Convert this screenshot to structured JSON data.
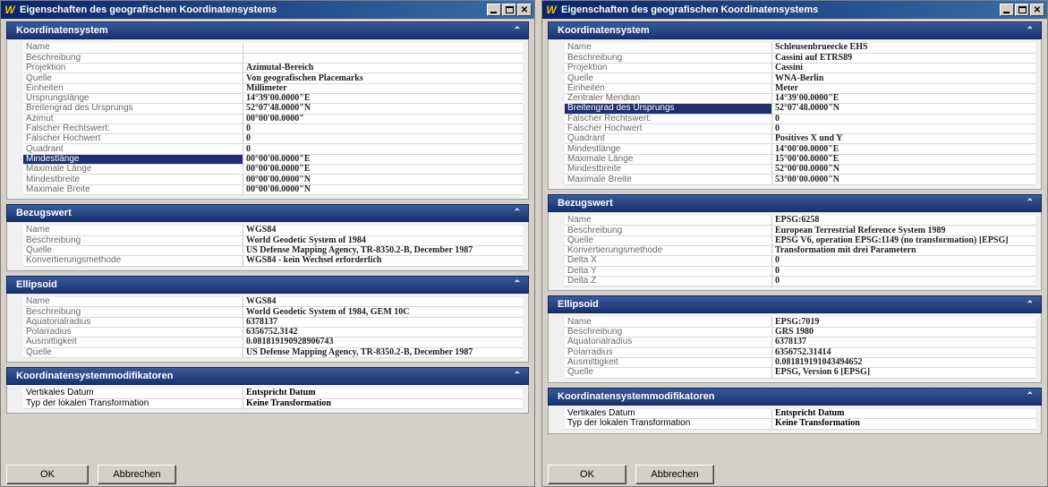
{
  "left": {
    "title": "Eigenschaften des geografischen Koordinatensystems",
    "app_icon": "wa-globe-icon",
    "sections": [
      {
        "title": "Koordinatensystem",
        "rows": [
          {
            "k": "Name",
            "v": ""
          },
          {
            "k": "Beschreibung",
            "v": ""
          },
          {
            "k": "Projektion",
            "v": "Azimutal-Bereich"
          },
          {
            "k": "Quelle",
            "v": "Von geografischen Placemarks"
          },
          {
            "k": "Einheiten",
            "v": "Millimeter"
          },
          {
            "k": "Ursprungslänge",
            "v": "14°39'00.0000\"E"
          },
          {
            "k": "Breitengrad des Ursprungs",
            "v": "52°07'48.0000\"N"
          },
          {
            "k": "Azimut",
            "v": "00°00'00.0000\""
          },
          {
            "k": "Falscher Rechtswert:",
            "v": "0"
          },
          {
            "k": "Falscher Hochwert",
            "v": "0"
          },
          {
            "k": "Quadrant",
            "v": "0"
          },
          {
            "k": "Mindestlänge",
            "v": "00°00'00.0000\"E",
            "selected": true
          },
          {
            "k": "Maximale Länge",
            "v": "00°00'00.0000\"E"
          },
          {
            "k": "Mindestbreite",
            "v": "00°00'00.0000\"N"
          },
          {
            "k": "Maximale Breite",
            "v": "00°00'00.0000\"N"
          }
        ]
      },
      {
        "title": "Bezugswert",
        "rows": [
          {
            "k": "Name",
            "v": "WGS84"
          },
          {
            "k": "Beschreibung",
            "v": "World Geodetic System of 1984"
          },
          {
            "k": "Quelle",
            "v": "US Defense Mapping Agency, TR-8350.2-B, December 1987"
          },
          {
            "k": "Konvertierungsmethode",
            "v": "WGS84 - kein Wechsel erforderlich"
          }
        ]
      },
      {
        "title": "Ellipsoid",
        "rows": [
          {
            "k": "Name",
            "v": "WGS84"
          },
          {
            "k": "Beschreibung",
            "v": "World Geodetic System of 1984, GEM 10C"
          },
          {
            "k": "Äquatorialradius",
            "v": "6378137"
          },
          {
            "k": "Polarradius",
            "v": "6356752.3142"
          },
          {
            "k": "Ausmittigkeit",
            "v": "0.081819190928906743"
          },
          {
            "k": "Quelle",
            "v": "US Defense Mapping Agency, TR-8350.2-B, December 1987"
          }
        ]
      },
      {
        "title": "Koordinatensystemmodifikatoren",
        "dark": true,
        "rows": [
          {
            "k": "Vertikales Datum",
            "v": "Entspricht Datum"
          },
          {
            "k": "Typ der lokalen Transformation",
            "v": "Keine Transformation"
          }
        ]
      }
    ],
    "ok_label": "OK",
    "cancel_label": "Abbrechen"
  },
  "right": {
    "title": "Eigenschaften des geografischen Koordinatensystems",
    "app_icon": "wa-globe-icon",
    "sections": [
      {
        "title": "Koordinatensystem",
        "rows": [
          {
            "k": "Name",
            "v": "Schleusenbrueecke EHS"
          },
          {
            "k": "Beschreibung",
            "v": "Cassini auf ETRS89"
          },
          {
            "k": "Projektion",
            "v": "Cassini"
          },
          {
            "k": "Quelle",
            "v": "WNA-Berlin"
          },
          {
            "k": "Einheiten",
            "v": "Meter"
          },
          {
            "k": "Zentraler Meridian",
            "v": "14°39'00.0000\"E"
          },
          {
            "k": "Breitengrad des Ursprungs",
            "v": "52°07'48.0000\"N",
            "selected": true
          },
          {
            "k": "Falscher Rechtswert:",
            "v": "0"
          },
          {
            "k": "Falscher Hochwert",
            "v": "0"
          },
          {
            "k": "Quadrant",
            "v": "Positives X und Y"
          },
          {
            "k": "Mindestlänge",
            "v": "14°00'00.0000\"E"
          },
          {
            "k": "Maximale Länge",
            "v": "15°00'00.0000\"E"
          },
          {
            "k": "Mindestbreite",
            "v": "52°00'00.0000\"N"
          },
          {
            "k": "Maximale Breite",
            "v": "53°00'00.0000\"N"
          }
        ]
      },
      {
        "title": "Bezugswert",
        "rows": [
          {
            "k": "Name",
            "v": "EPSG:6258"
          },
          {
            "k": "Beschreibung",
            "v": "European Terrestrial Reference System 1989"
          },
          {
            "k": "Quelle",
            "v": "EPSG V6, operation EPSG:1149 (no transformation) [EPSG]"
          },
          {
            "k": "Konvertierungsmethode",
            "v": "Transformation mit drei Parametern"
          },
          {
            "k": "Delta X",
            "v": "0"
          },
          {
            "k": "Delta Y",
            "v": "0"
          },
          {
            "k": "Delta Z",
            "v": "0"
          }
        ]
      },
      {
        "title": "Ellipsoid",
        "rows": [
          {
            "k": "Name",
            "v": "EPSG:7019"
          },
          {
            "k": "Beschreibung",
            "v": "GRS 1980"
          },
          {
            "k": "Äquatorialradius",
            "v": "6378137"
          },
          {
            "k": "Polarradius",
            "v": "6356752.31414"
          },
          {
            "k": "Ausmittigkeit",
            "v": "0.081819191043494652"
          },
          {
            "k": "Quelle",
            "v": "EPSG, Version 6 [EPSG]"
          }
        ]
      },
      {
        "title": "Koordinatensystemmodifikatoren",
        "dark": true,
        "rows": [
          {
            "k": "Vertikales Datum",
            "v": "Entspricht Datum"
          },
          {
            "k": "Typ der lokalen Transformation",
            "v": "Keine Transformation"
          }
        ]
      }
    ],
    "ok_label": "OK",
    "cancel_label": "Abbrechen"
  }
}
